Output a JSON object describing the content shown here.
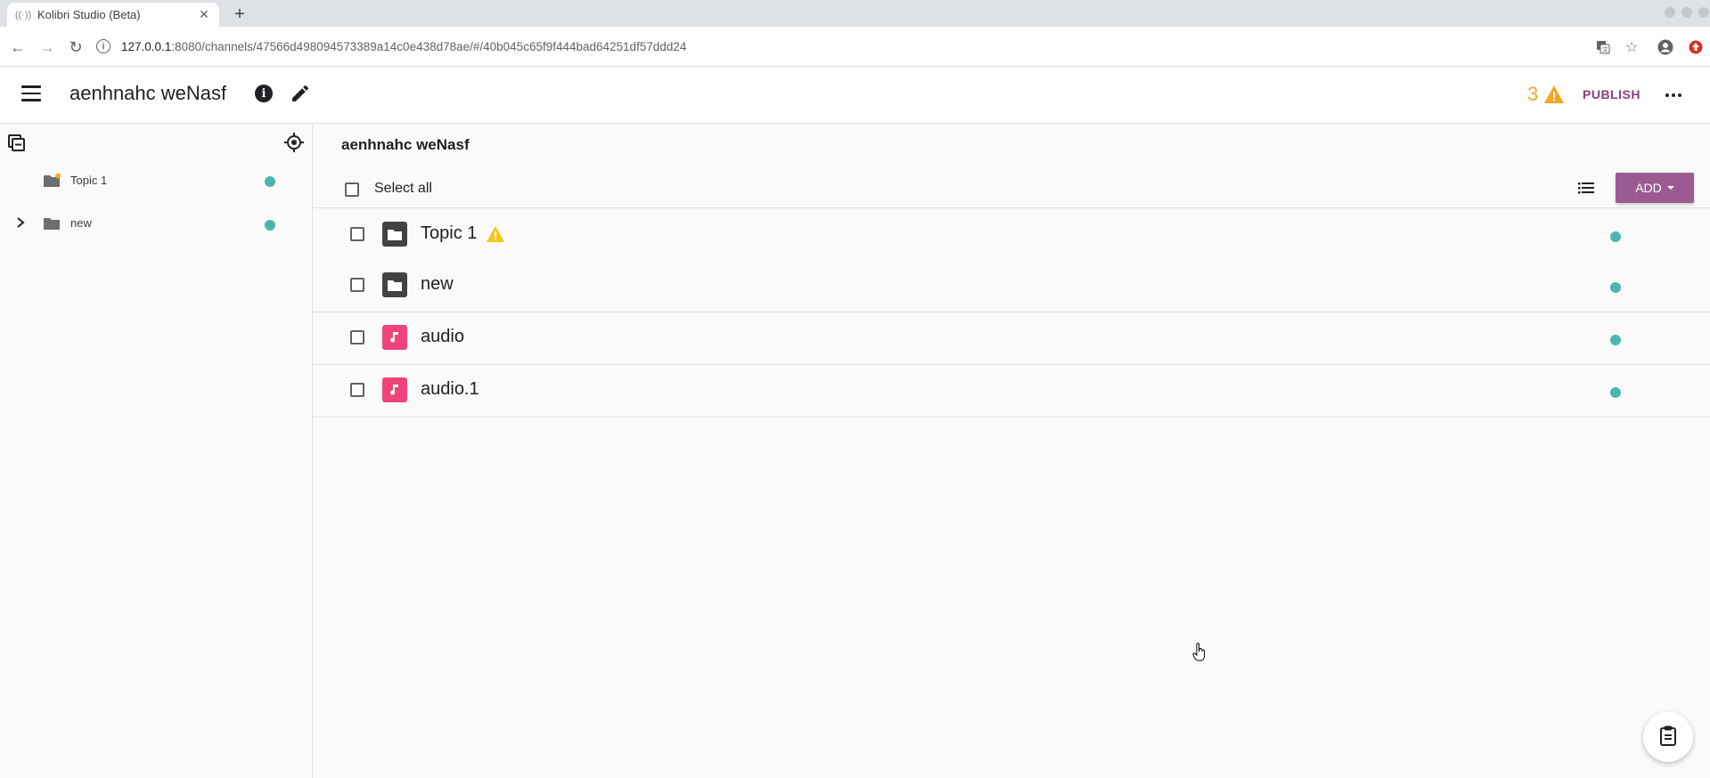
{
  "browser": {
    "tab_title": "Kolibri Studio (Beta)",
    "url_host": "127.0.0.1",
    "url_rest": ":8080/channels/47566d498094573389a14c0e438d78ae/#/40b045c65f9f444bad64251df57ddd24"
  },
  "header": {
    "channel_name": "aenhnahc weNasf",
    "warning_count": "3",
    "publish_label": "PUBLISH"
  },
  "sidebar": {
    "items": [
      {
        "label": "Topic 1"
      },
      {
        "label": "new"
      }
    ]
  },
  "main": {
    "title": "aenhnahc weNasf",
    "select_all_label": "Select all",
    "add_label": "ADD",
    "rows": [
      {
        "title": "Topic 1",
        "kind": "topic",
        "has_warning": true
      },
      {
        "title": "new",
        "kind": "topic",
        "has_warning": false
      },
      {
        "title": "audio",
        "kind": "audio",
        "has_warning": false
      },
      {
        "title": "audio.1",
        "kind": "audio",
        "has_warning": false
      }
    ]
  },
  "colors": {
    "accent": "#9c5a93",
    "publish_text": "#8a3f7b",
    "warning": "#f5a623",
    "status_dot": "#4db6ac",
    "audio_icon_bg": "#f0437a",
    "topic_icon_bg": "#424242"
  }
}
